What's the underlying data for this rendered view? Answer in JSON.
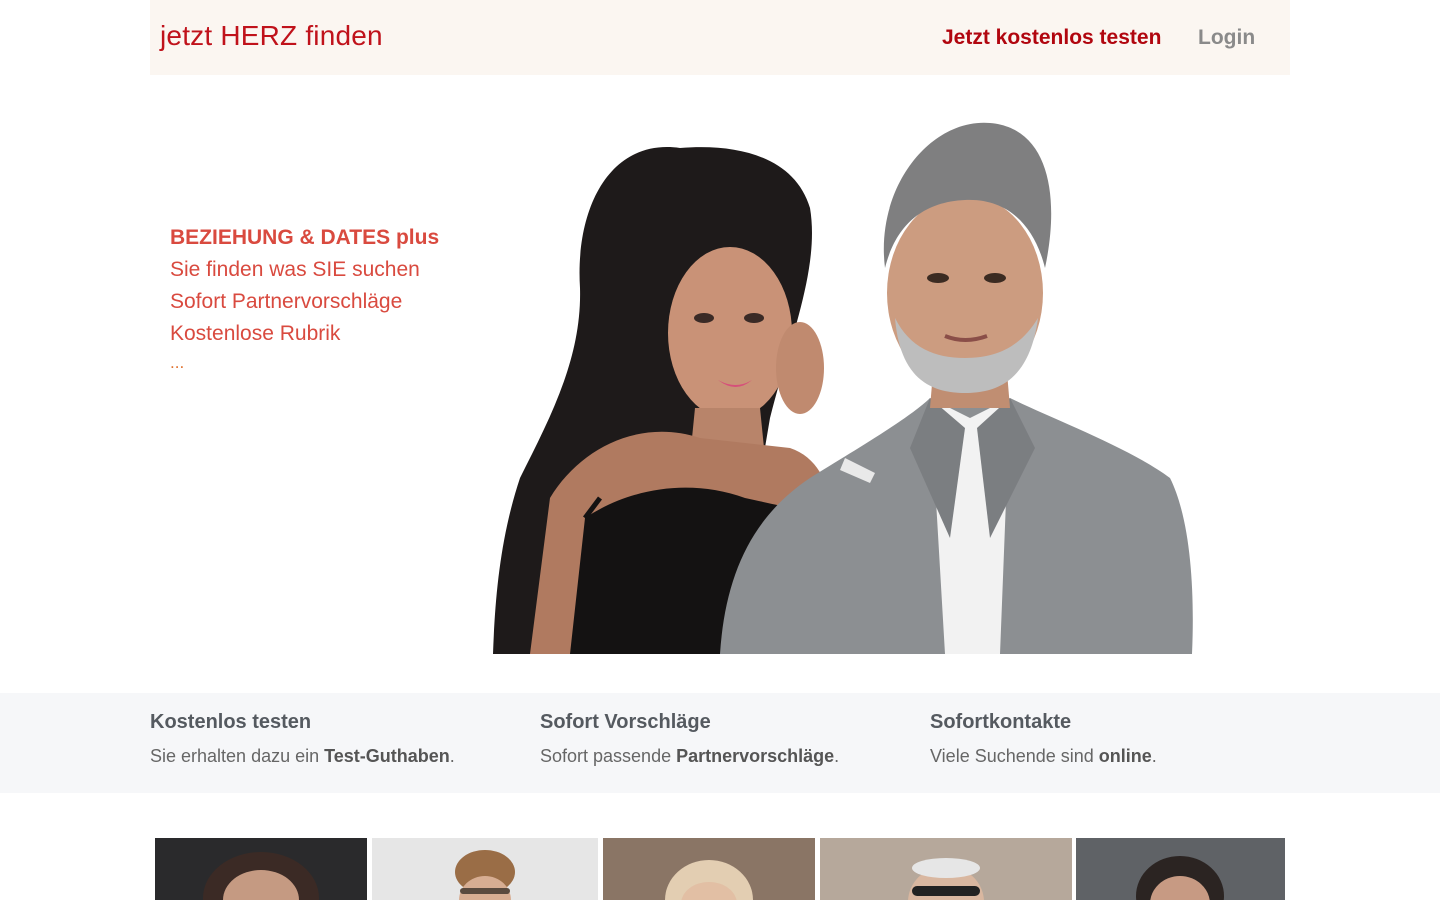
{
  "header": {
    "brand": "jetzt HERZ finden",
    "cta": "Jetzt kostenlos testen",
    "login": "Login"
  },
  "hero": {
    "headline": "BEZIEHUNG & DATES plus",
    "lines": [
      "Sie finden was SIE suchen",
      "Sofort Partnervorschläge",
      "Kostenlose Rubrik"
    ],
    "ellipsis": "..."
  },
  "features": [
    {
      "title": "Kostenlos testen",
      "prefix": "Sie erhalten dazu ein ",
      "highlight": "Test-Guthaben",
      "suffix": "."
    },
    {
      "title": "Sofort Vorschläge",
      "prefix": "Sofort passende ",
      "highlight": "Partnervorschläge",
      "suffix": "."
    },
    {
      "title": "Sofortkontakte",
      "prefix": "Viele Suchende sind ",
      "highlight": "online",
      "suffix": "."
    }
  ],
  "colors": {
    "brand": "#c0121b",
    "hero_text": "#d94a3f",
    "header_bg": "#fbf6f1",
    "features_bg": "#f6f7f9"
  }
}
